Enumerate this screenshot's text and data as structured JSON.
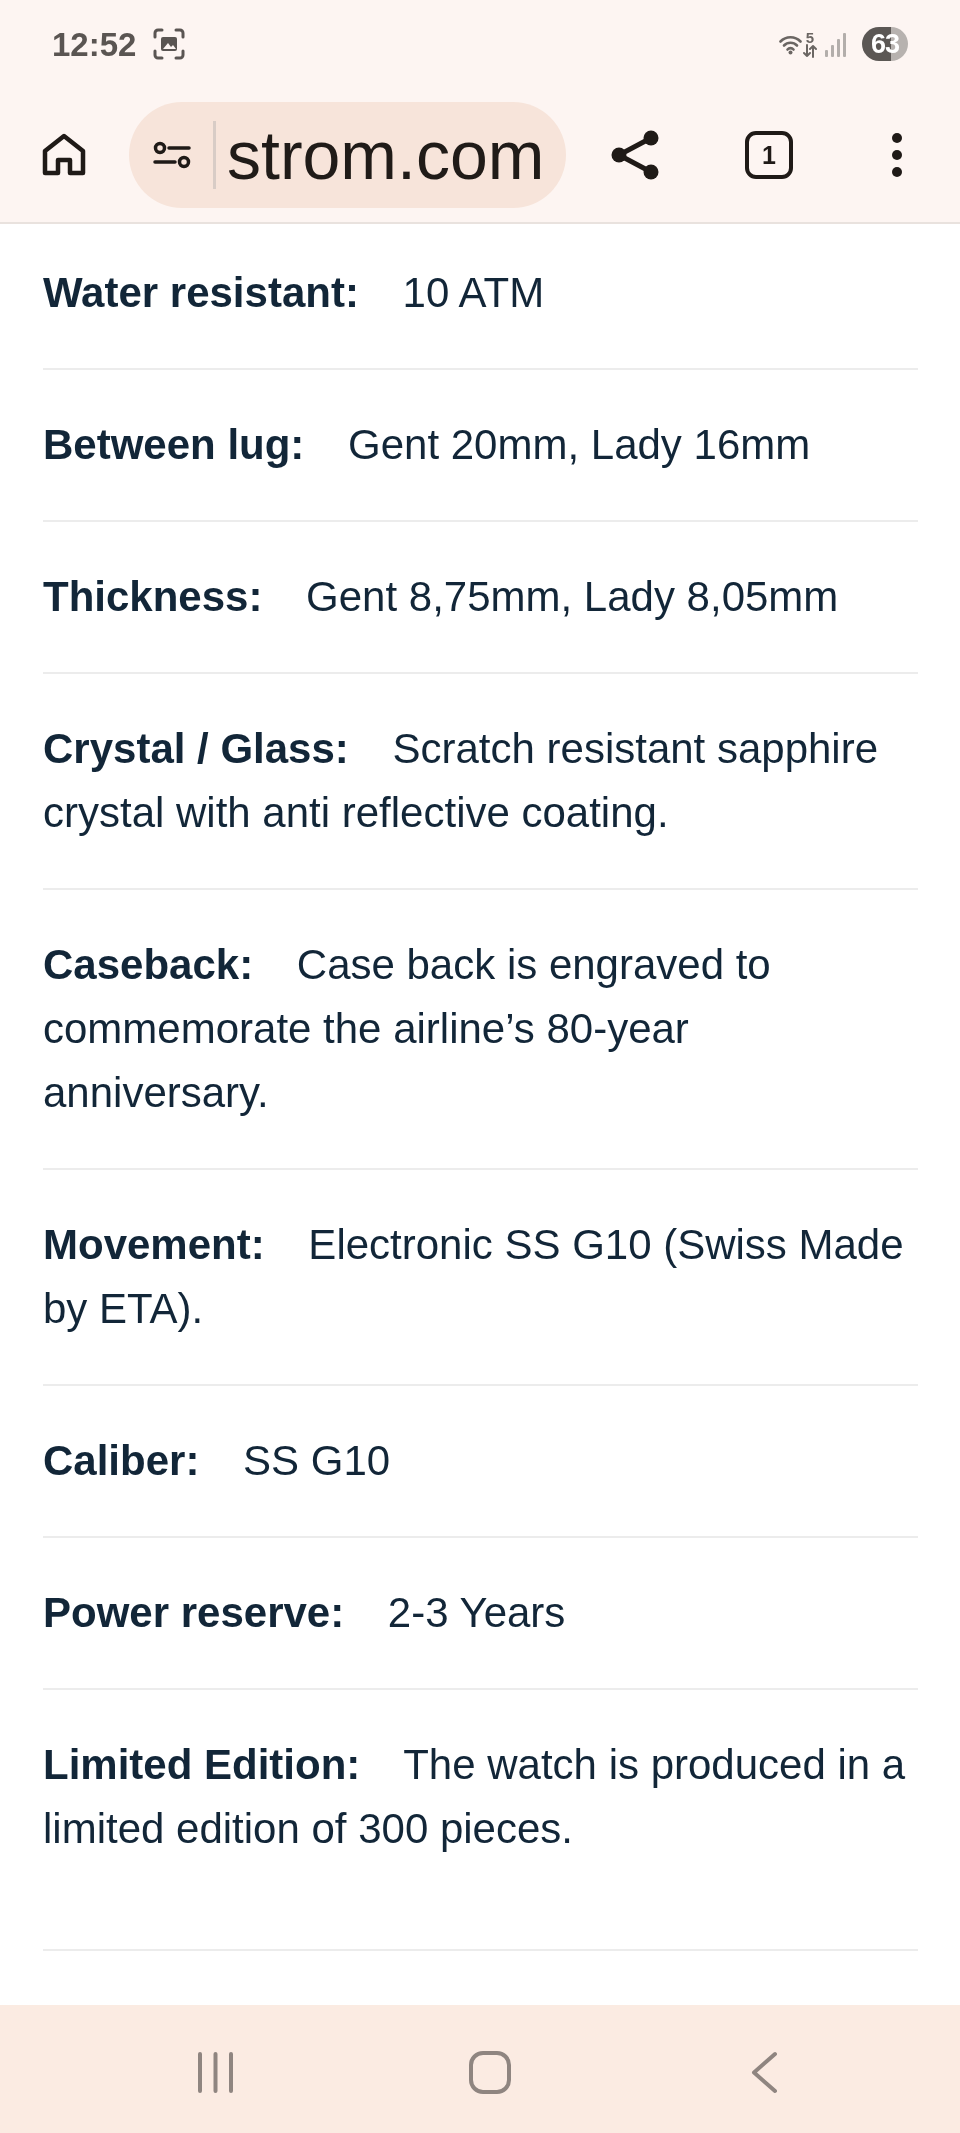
{
  "status_bar": {
    "time": "12:52",
    "wifi_label": "5",
    "battery": "63"
  },
  "toolbar": {
    "url": "strom.com",
    "tab_count": "1"
  },
  "specs": [
    {
      "label": "Water resistant:",
      "value": "10 ATM"
    },
    {
      "label": "Between lug:",
      "value": "Gent 20mm, Lady 16mm"
    },
    {
      "label": "Thickness:",
      "value": "Gent 8,75mm, Lady 8,05mm"
    },
    {
      "label": "Crystal / Glass:",
      "value": "Scratch resistant sapphire crystal with anti reflective coating."
    },
    {
      "label": "Caseback:",
      "value": "Case back is engraved to commemorate the airline’s 80-year anniversary."
    },
    {
      "label": "Movement:",
      "value": "Electronic SS G10 (Swiss Made by ETA)."
    },
    {
      "label": "Caliber:",
      "value": "SS G10"
    },
    {
      "label": "Power reserve:",
      "value": "2-3 Years"
    },
    {
      "label": "Limited Edition:",
      "value": "The watch is produced in a limited edition of 300 pieces."
    }
  ]
}
